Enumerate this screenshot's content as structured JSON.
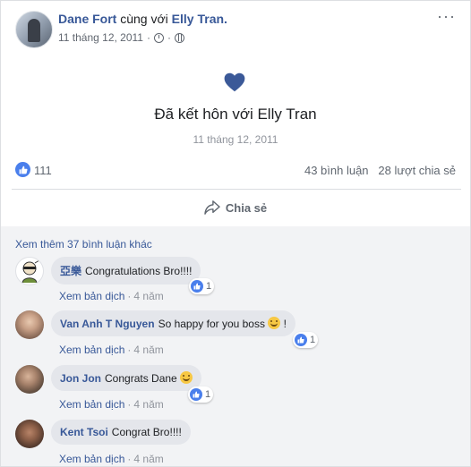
{
  "post": {
    "author": "Dane Fort",
    "with_text": "cùng với",
    "tagged": "Elly Tran.",
    "date": "11 tháng 12, 2011",
    "more_icon": "ellipsis-icon",
    "privacy_icon": "globe-icon"
  },
  "life_event": {
    "icon": "heart-icon",
    "title": "Đã kết hôn với Elly Tran",
    "date": "11 tháng 12, 2011"
  },
  "stats": {
    "likes": "111",
    "comments": "43 bình luận",
    "shares": "28 lượt chia sẻ"
  },
  "actions": {
    "share_label": "Chia sẻ"
  },
  "comments": {
    "more_label": "Xem thêm 37 bình luận khác",
    "items": [
      {
        "name": "亞樂",
        "text": "Congratulations Bro!!!!",
        "emoji": "",
        "reactions": "1",
        "translate": "Xem bản dịch",
        "age": "4 năm"
      },
      {
        "name": "Van Anh T Nguyen",
        "text": "So happy for you boss",
        "emoji": "!",
        "reactions": "1",
        "translate": "Xem bản dịch",
        "age": "4 năm"
      },
      {
        "name": "Jon Jon",
        "text": "Congrats Dane",
        "emoji": "",
        "reactions": "1",
        "translate": "Xem bản dịch",
        "age": "4 năm"
      },
      {
        "name": "Kent Tsoi",
        "text": "Congrat Bro!!!!",
        "emoji": "",
        "reactions": "",
        "translate": "Xem bản dịch",
        "age": "4 năm"
      }
    ]
  },
  "colors": {
    "link": "#385898",
    "like_blue": "#4a7fec",
    "heart": "#3b5998",
    "comment_bg": "#f2f3f5"
  }
}
